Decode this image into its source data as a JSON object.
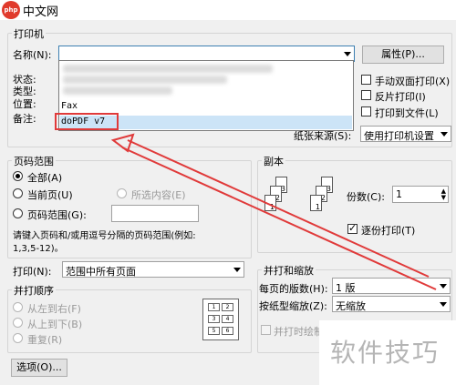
{
  "title_bar": {
    "logo_text": "php",
    "title": "中文网"
  },
  "printer": {
    "group_title": "打印机",
    "name_label": "名称(N):",
    "name_value": "",
    "properties_button": "属性(P)...",
    "status_label": "状态:",
    "type_label": "类型:",
    "where_label": "位置:",
    "comment_label": "备注:",
    "dropdown_items": [
      "Fax",
      "doPDF v7"
    ],
    "manual_duplex": "手动双面打印(X)",
    "reverse_print": "反片打印(I)",
    "print_to_file": "打印到文件(L)",
    "paper_source_label": "纸张来源(S):",
    "paper_source_value": "使用打印机设置"
  },
  "page_range": {
    "group_title": "页码范围",
    "all": "全部(A)",
    "current_page": "当前页(U)",
    "selection": "所选内容(E)",
    "pages": "页码范围(G):",
    "pages_value": "",
    "hint_line1": "请键入页码和/或用逗号分隔的页码范围(例如:",
    "hint_line2": "1,3,5-12)。"
  },
  "print_what": {
    "label": "打印(N):",
    "value": "范围中所有页面"
  },
  "print_order": {
    "group_title": "并打顺序",
    "left_to_right": "从左到右(F)",
    "top_to_bottom": "从上到下(B)",
    "repeat": "重复(R)",
    "cells": [
      "1",
      "2",
      "3",
      "4",
      "5",
      "6"
    ]
  },
  "copies": {
    "group_title": "副本",
    "copies_label": "份数(C):",
    "copies_value": "1",
    "collate": "逐份打印(T)",
    "page_numbers": [
      "1",
      "2",
      "3",
      "1",
      "2",
      "3"
    ]
  },
  "zoom": {
    "group_title": "并打和缩放",
    "pages_per_sheet_label": "每页的版数(H):",
    "pages_per_sheet_value": "1 版",
    "scale_label": "按纸型缩放(Z):",
    "scale_value": "无缩放",
    "collate_print": "并打时绘制"
  },
  "options_button": "选项(O)...",
  "watermark": "软件技巧",
  "colors": {
    "highlight": "#e03a3a",
    "selection": "#cce4f7",
    "arrow": "#e03a3a"
  }
}
